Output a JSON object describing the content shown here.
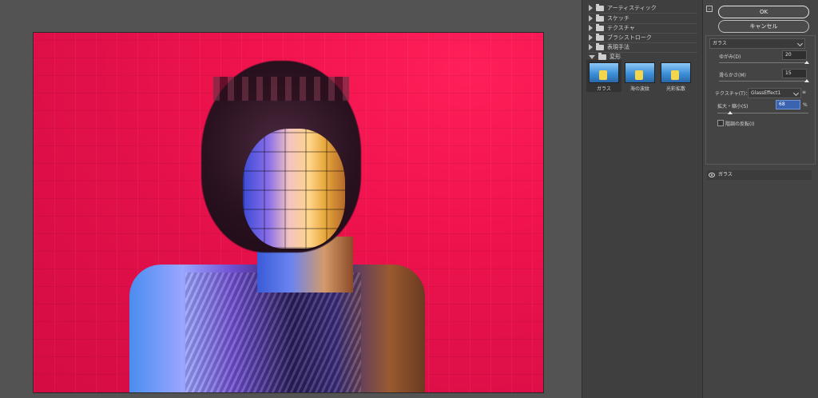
{
  "filter_categories": [
    {
      "label": "アーティスティック",
      "expanded": false
    },
    {
      "label": "スケッチ",
      "expanded": false
    },
    {
      "label": "テクスチャ",
      "expanded": false
    },
    {
      "label": "ブラシストローク",
      "expanded": false
    },
    {
      "label": "表現手法",
      "expanded": false
    },
    {
      "label": "変形",
      "expanded": true
    }
  ],
  "distort_filters": [
    {
      "label": "ガラス",
      "selected": true
    },
    {
      "label": "海の波紋",
      "selected": false
    },
    {
      "label": "光彩拡散",
      "selected": false
    }
  ],
  "buttons": {
    "ok": "OK",
    "cancel": "キャンセル"
  },
  "filter_select": {
    "value": "ガラス"
  },
  "distortion": {
    "label": "ゆがみ(D)",
    "value": "20",
    "slider_fraction": 1.0
  },
  "smoothness": {
    "label": "滑らかさ(M)",
    "value": "15",
    "slider_fraction": 1.0
  },
  "texture": {
    "label": "テクスチャ(T)：",
    "value": "GlassEffect1"
  },
  "scaling": {
    "label": "拡大・縮小(S)",
    "value": "68",
    "unit": "%",
    "slider_fraction": 0.14
  },
  "invert": {
    "label": "階調の反転(I)",
    "checked": false
  },
  "effect_layers": [
    {
      "label": "ガラス",
      "visible": true
    }
  ],
  "collapse_icon_symbol": "⌄",
  "colors": {
    "accent_highlight": "#3a64b0",
    "panel_bg": "#444444",
    "canvas_red": "#e2104a"
  }
}
